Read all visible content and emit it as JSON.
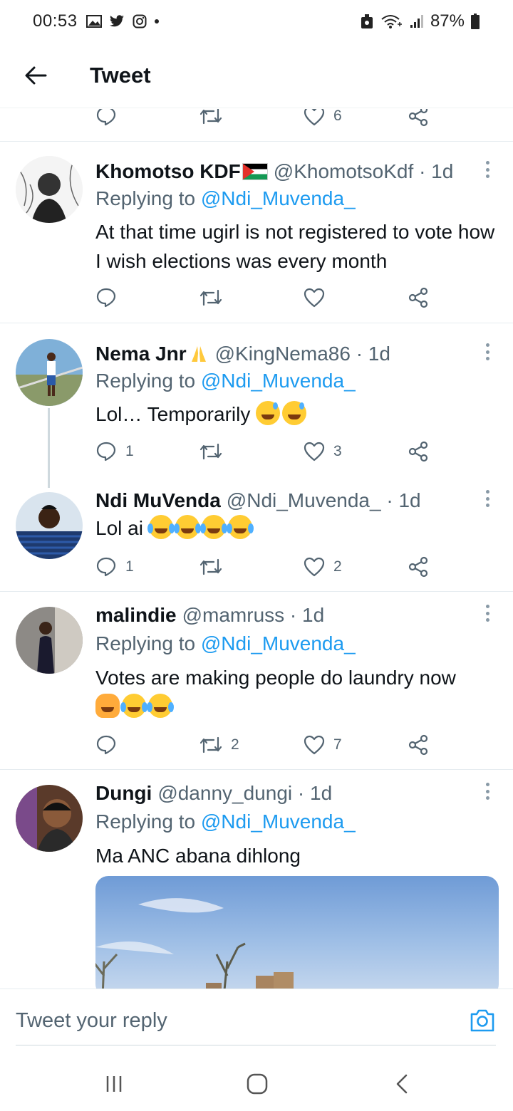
{
  "status_bar": {
    "time": "00:53",
    "battery": "87%"
  },
  "header": {
    "title": "Tweet"
  },
  "top_actions": {
    "likes": "6"
  },
  "tweets": [
    {
      "name": "Khomotso KDF",
      "handle": "@KhomotsoKdf · 1d",
      "replying_prefix": "Replying to ",
      "replying_to": "@Ndi_Muvenda_",
      "text": "At that time ugirl is not registered to vote how I wish elections was every month",
      "replies": "",
      "retweets": "",
      "likes": ""
    },
    {
      "name": "Nema Jnr",
      "handle": "@KingNema86 · 1d",
      "replying_prefix": "Replying to ",
      "replying_to": "@Ndi_Muvenda_",
      "text": "Lol… Temporarily ",
      "replies": "1",
      "retweets": "",
      "likes": "3"
    },
    {
      "name": "Ndi MuVenda",
      "handle": "@Ndi_Muvenda_ · 1d",
      "text": "Lol ai ",
      "replies": "1",
      "retweets": "",
      "likes": "2"
    },
    {
      "name": "malindie",
      "handle": "@mamruss · 1d",
      "replying_prefix": "Replying to ",
      "replying_to": "@Ndi_Muvenda_",
      "text": "Votes are making people do laundry now",
      "replies": "",
      "retweets": "2",
      "likes": "7"
    },
    {
      "name": "Dungi",
      "handle": "@danny_dungi · 1d",
      "replying_prefix": "Replying to ",
      "replying_to": "@Ndi_Muvenda_",
      "text": "Ma ANC abana dihlong"
    }
  ],
  "reply_bar": {
    "placeholder": "Tweet your reply"
  },
  "colors": {
    "accent": "#1d9bf0",
    "secondary_text": "#536471",
    "divider": "#e6ecf0"
  }
}
